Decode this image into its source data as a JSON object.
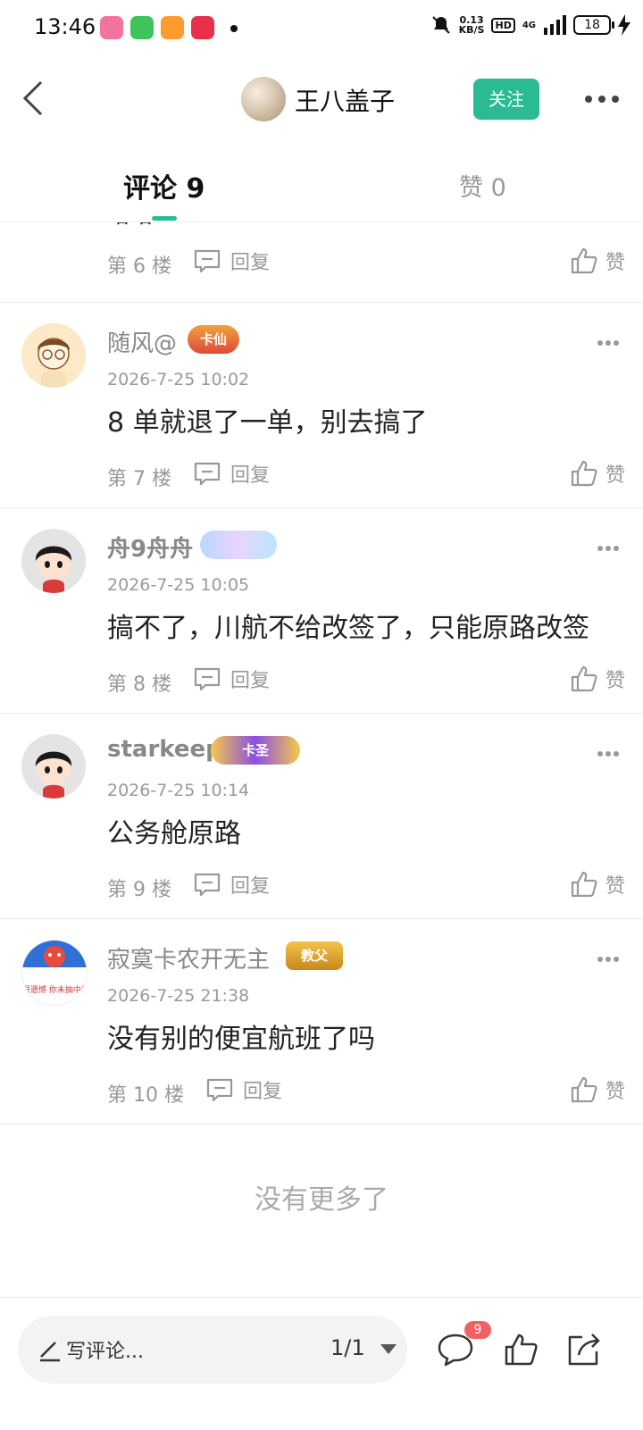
{
  "status": {
    "time": "13:46",
    "net_speed_value": "0.13",
    "net_speed_unit": "KB/S",
    "hd": "HD",
    "network": "4G",
    "battery": "18"
  },
  "header": {
    "title": "王八盖子",
    "follow_label": "关注"
  },
  "tabs": {
    "comments_label": "评论 9",
    "likes_label": "赞 0"
  },
  "partial": {
    "text": "哈哈",
    "floor": "第 6 楼",
    "reply": "回复",
    "like": "赞"
  },
  "comments": [
    {
      "name": "随风@",
      "badge": "卡仙",
      "time": "2026-7-25 10:02",
      "text": "8 单就退了一单，别去搞了",
      "floor": "第 7 楼",
      "reply": "回复",
      "like": "赞"
    },
    {
      "name": "舟9舟舟",
      "badge": "",
      "time": "2026-7-25 10:05",
      "text": "搞不了，川航不给改签了，只能原路改签",
      "floor": "第 8 楼",
      "reply": "回复",
      "like": "赞"
    },
    {
      "name": "starkeep",
      "badge": "卡圣",
      "time": "2026-7-25 10:14",
      "text": "公务舱原路",
      "floor": "第 9 楼",
      "reply": "回复",
      "like": "赞"
    },
    {
      "name": "寂寞卡农开无主",
      "badge": "教父",
      "time": "2026-7-25 21:38",
      "text": "没有别的便宜航班了吗",
      "floor": "第 10 楼",
      "reply": "回复",
      "like": "赞"
    }
  ],
  "avatar4_caption": "很遗憾 你未抽中奖励",
  "no_more": "没有更多了",
  "bottom": {
    "write_label": "写评论...",
    "page": "1/1",
    "comment_count": "9"
  },
  "colors": {
    "accent": "#2bbb94",
    "badge_red": "#f06161"
  }
}
